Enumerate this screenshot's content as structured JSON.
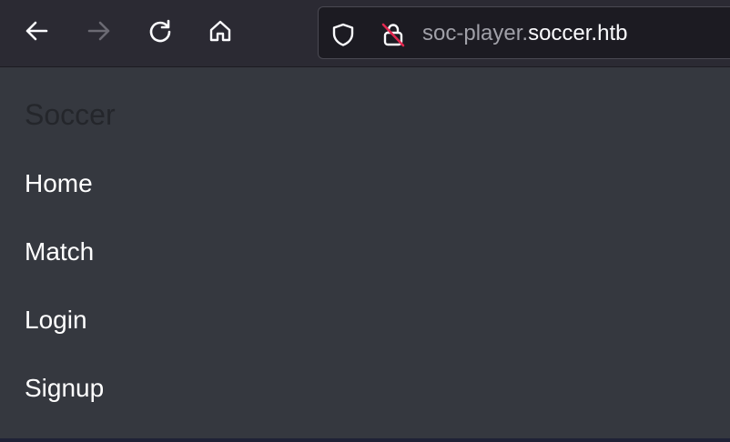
{
  "browser": {
    "icons": {
      "back": "arrow-left-icon",
      "forward": "arrow-right-icon",
      "reload": "reload-icon",
      "home": "home-icon",
      "tracking": "shield-icon",
      "security": "insecure-lock-icon"
    },
    "url": {
      "subdomain": "soc-player.",
      "domain": "soccer.htb"
    },
    "forward_disabled": true
  },
  "page": {
    "brand": "Soccer",
    "menu": [
      {
        "label": "Home"
      },
      {
        "label": "Match"
      },
      {
        "label": "Login"
      },
      {
        "label": "Signup"
      }
    ]
  },
  "colors": {
    "toolbar_bg": "#2b2a33",
    "page_bg": "#35383f",
    "brand_text": "#24262b",
    "menu_text": "#ffffff",
    "insecure_slash": "#e22850"
  }
}
